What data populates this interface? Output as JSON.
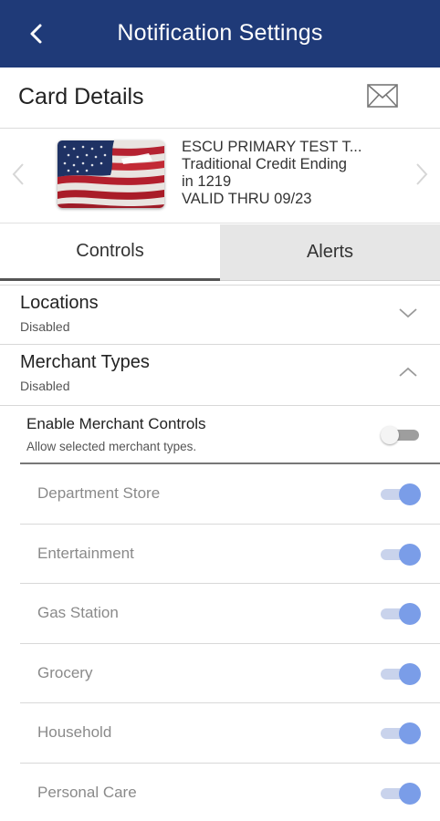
{
  "header": {
    "title": "Notification Settings",
    "back_icon": "chevron-left-icon",
    "background_color": "#1f3a78"
  },
  "card_details": {
    "title": "Card Details",
    "mail_icon": "envelope-icon"
  },
  "card": {
    "name": "ESCU PRIMARY TEST T...",
    "description_line1": "Traditional Credit Ending",
    "description_line2": "in 1219",
    "valid_thru": "VALID THRU 09/23",
    "image_icon": "american-flag-card-image"
  },
  "tabs": [
    {
      "label": "Controls",
      "selected": true
    },
    {
      "label": "Alerts",
      "selected": false
    }
  ],
  "sections": {
    "locations": {
      "title": "Locations",
      "status": "Disabled",
      "expanded": false
    },
    "merchant_types": {
      "title": "Merchant Types",
      "status": "Disabled",
      "expanded": true
    }
  },
  "merchant_controls": {
    "title": "Enable Merchant Controls",
    "subtitle": "Allow selected merchant types.",
    "enabled": false
  },
  "merchants": [
    {
      "label": "Department Store",
      "on": true
    },
    {
      "label": "Entertainment",
      "on": true
    },
    {
      "label": "Gas Station",
      "on": true
    },
    {
      "label": "Grocery",
      "on": true
    },
    {
      "label": "Household",
      "on": true
    },
    {
      "label": "Personal Care",
      "on": true
    }
  ],
  "colors": {
    "toggle_on_knob": "#7a9de8",
    "toggle_on_track": "#c9d3ec",
    "tab_inactive_bg": "#e6e6e6"
  }
}
